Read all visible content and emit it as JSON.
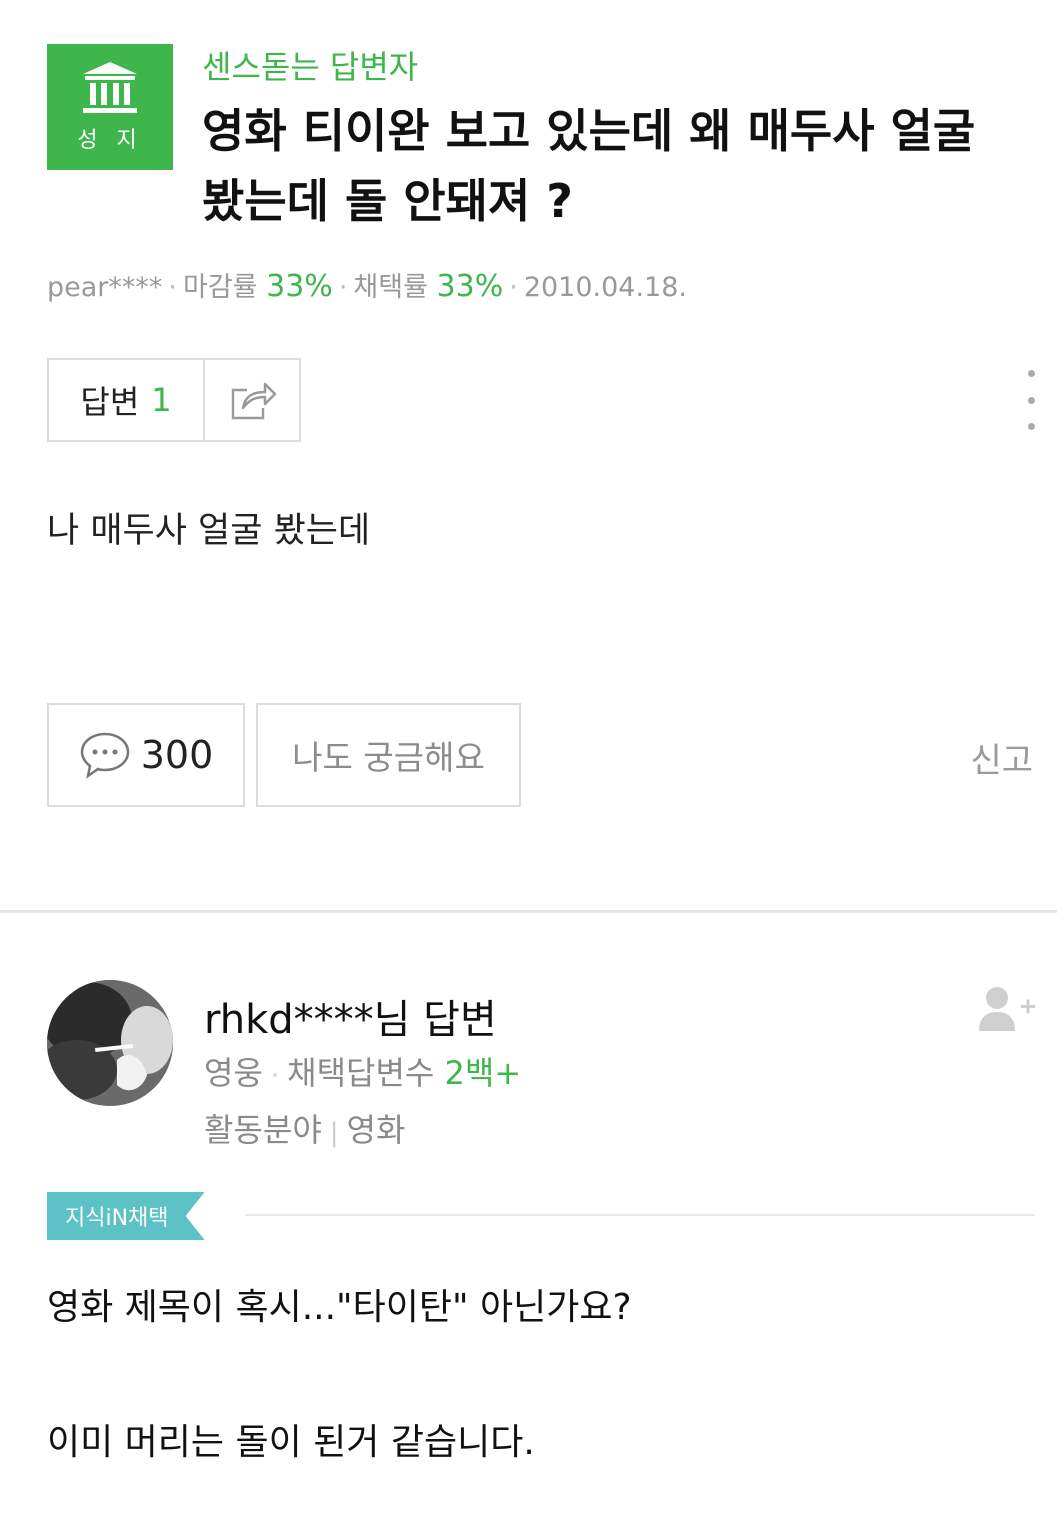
{
  "question": {
    "badge_label": "성 지",
    "category": "센스돋는 답변자",
    "title": "영화 티이완 보고 있는데 왜 매두사 얼굴 봤는데 돌 안돼져 ?",
    "author": "pear****",
    "close_rate_label": "마감률",
    "close_rate_value": "33%",
    "adopt_rate_label": "채택률",
    "adopt_rate_value": "33%",
    "date": "2010.04.18.",
    "answer_label": "답변",
    "answer_count": "1",
    "body": "나 매두사 얼굴 봤는데",
    "comment_count": "300",
    "curious_label": "나도 궁금해요",
    "report_label": "신고"
  },
  "answer": {
    "author_line": "rhkd****님 답변",
    "rank": "영웅",
    "adopted_label": "채택답변수",
    "adopted_count": "2백+",
    "field_label": "활동분야",
    "field_value": "영화",
    "chosen_tag": "지식iN채택",
    "text_line1": "영화 제목이 혹시...\"타이탄\" 아닌가요?",
    "text_line2": "이미 머리는 돌이 된거 같습니다."
  },
  "colors": {
    "accent_green": "#3fb64c",
    "tag_teal": "#5cc2c6",
    "border_gray": "#dcdcdc"
  },
  "icons": {
    "badge": "temple-icon",
    "share": "share-icon",
    "more": "more-vertical-icon",
    "comment": "speech-bubble-icon",
    "follow": "add-user-icon"
  }
}
